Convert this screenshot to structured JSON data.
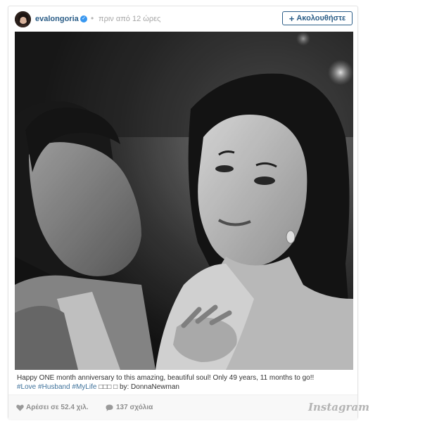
{
  "header": {
    "username": "evalongoria",
    "verified_icon": "check-badge-icon",
    "separator": "•",
    "timestamp": "πριν από 12 ώρες",
    "follow_plus": "+",
    "follow_label": "Ακολουθήστε"
  },
  "photo": {
    "style": "black-and-white"
  },
  "caption": {
    "text": "Happy ONE month anniversary to this amazing, beautiful soul! Only 49 years, 11 months to go!!",
    "hashtags": [
      "#Love",
      "#Husband",
      "#MyLife"
    ],
    "emoji": "□□□ □",
    "credit": "by: DonnaNewman"
  },
  "footer": {
    "likes": "Αρέσει σε 52.4 χιλ.",
    "comments": "137 σχόλια",
    "brand": "Instagram"
  },
  "colors": {
    "link": "#2b5d87",
    "hashtag": "#3f729b",
    "muted": "#8e8e8e",
    "border": "#e3e3e3"
  }
}
